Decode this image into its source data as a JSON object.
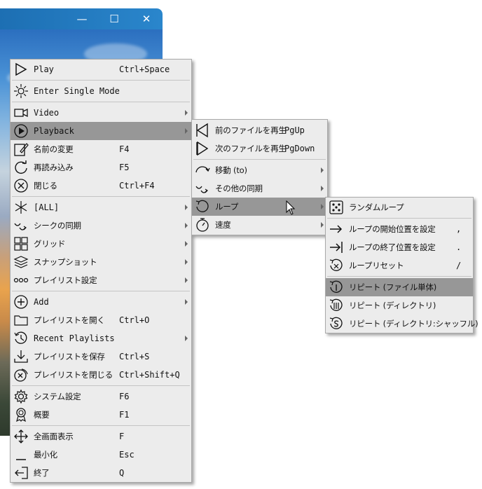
{
  "window": {
    "minimize": "—",
    "maximize": "☐",
    "close": "✕"
  },
  "main_menu": [
    {
      "label": "Play",
      "shortcut": "Ctrl+Space",
      "icon": "play-icon"
    },
    {
      "label": "Enter Single Mode",
      "shortcut": "",
      "icon": "single-mode-icon"
    },
    {
      "label": "Video",
      "shortcut": "",
      "icon": "video-camera-icon",
      "submenu": true
    },
    {
      "label": "Playback",
      "shortcut": "",
      "icon": "playback-icon",
      "submenu": true,
      "highlighted": true
    },
    {
      "label": "名前の変更",
      "shortcut": "F4",
      "icon": "rename-icon"
    },
    {
      "label": "再読み込み",
      "shortcut": "F5",
      "icon": "reload-icon"
    },
    {
      "label": "閉じる",
      "shortcut": "Ctrl+F4",
      "icon": "close-circle-icon"
    },
    {
      "label": "[ALL]",
      "shortcut": "",
      "icon": "asterisk-icon",
      "submenu": true
    },
    {
      "label": "シークの同期",
      "shortcut": "",
      "icon": "sync-seek-icon",
      "submenu": true
    },
    {
      "label": "グリッド",
      "shortcut": "",
      "icon": "grid-icon",
      "submenu": true
    },
    {
      "label": "スナップショット",
      "shortcut": "",
      "icon": "snapshot-icon",
      "submenu": true
    },
    {
      "label": "プレイリスト設定",
      "shortcut": "",
      "icon": "playlist-settings-icon",
      "submenu": true
    },
    {
      "label": "Add",
      "shortcut": "",
      "icon": "add-icon",
      "submenu": true
    },
    {
      "label": "プレイリストを開く",
      "shortcut": "Ctrl+O",
      "icon": "folder-icon"
    },
    {
      "label": "Recent Playlists",
      "shortcut": "",
      "icon": "history-icon",
      "submenu": true
    },
    {
      "label": "プレイリストを保存",
      "shortcut": "Ctrl+S",
      "icon": "save-download-icon"
    },
    {
      "label": "プレイリストを閉じる",
      "shortcut": "Ctrl+Shift+Q",
      "icon": "close-playlist-icon"
    },
    {
      "label": "システム設定",
      "shortcut": "F6",
      "icon": "gear-icon"
    },
    {
      "label": "概要",
      "shortcut": "F1",
      "icon": "award-icon"
    },
    {
      "label": "全画面表示",
      "shortcut": "F",
      "icon": "fullscreen-arrows-icon"
    },
    {
      "label": "最小化",
      "shortcut": "Esc",
      "icon": "minimize-icon"
    },
    {
      "label": "終了",
      "shortcut": "Q",
      "icon": "exit-icon"
    }
  ],
  "playback_menu": [
    {
      "label": "前のファイルを再生",
      "shortcut": "PgUp",
      "icon": "previous-file-icon"
    },
    {
      "label": "次のファイルを再生",
      "shortcut": "PgDown",
      "icon": "next-file-icon"
    },
    {
      "label": "移動 (to)",
      "shortcut": "",
      "icon": "move-to-icon",
      "submenu": true
    },
    {
      "label": "その他の同期",
      "shortcut": "",
      "icon": "other-sync-icon",
      "submenu": true
    },
    {
      "label": "ループ",
      "shortcut": "",
      "icon": "loop-icon",
      "submenu": true,
      "highlighted": true
    },
    {
      "label": "速度",
      "shortcut": "",
      "icon": "speed-timer-icon",
      "submenu": true
    }
  ],
  "loop_menu": [
    {
      "label": "ランダムループ",
      "shortcut": "",
      "icon": "dice-icon"
    },
    {
      "label": "ループの開始位置を設定",
      "shortcut": ",",
      "icon": "set-start-icon"
    },
    {
      "label": "ループの終了位置を設定",
      "shortcut": ".",
      "icon": "set-end-icon"
    },
    {
      "label": "ループリセット",
      "shortcut": "/",
      "icon": "loop-reset-icon"
    },
    {
      "label": "リピート (ファイル単体)",
      "shortcut": "",
      "icon": "repeat-one-icon",
      "highlighted": true
    },
    {
      "label": "リピート (ディレクトリ)",
      "shortcut": "",
      "icon": "repeat-directory-icon"
    },
    {
      "label": "リピート (ディレクトリ:シャッフル)",
      "shortcut": "",
      "icon": "repeat-shuffle-icon"
    }
  ]
}
